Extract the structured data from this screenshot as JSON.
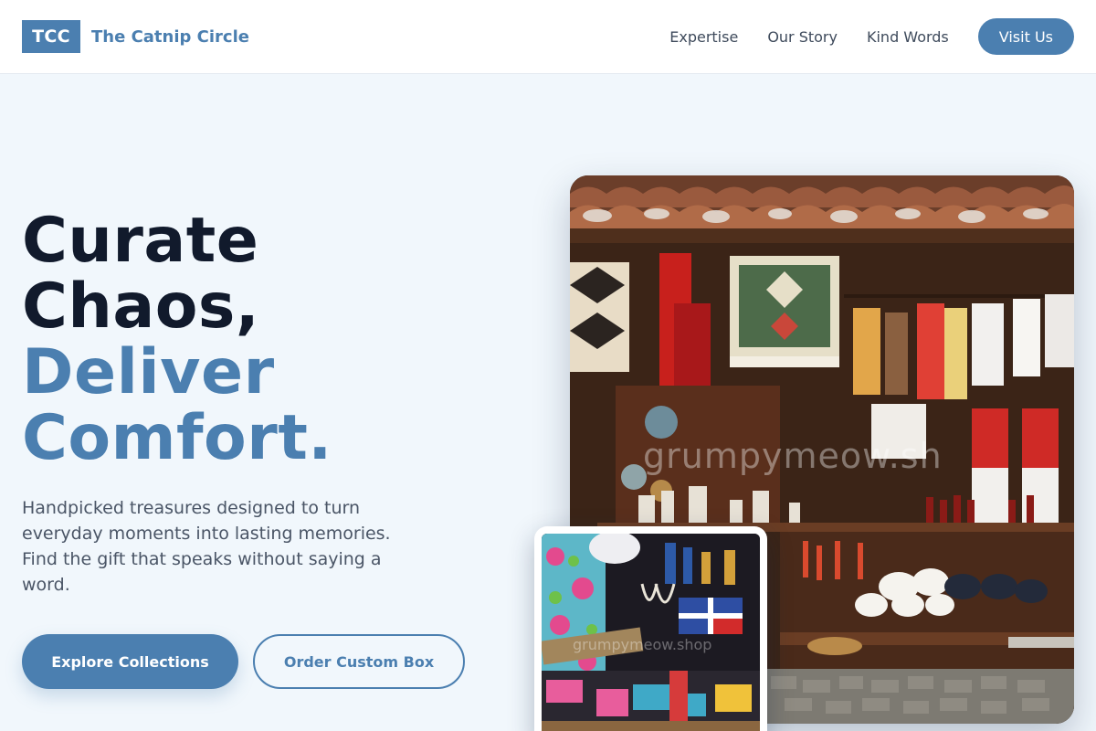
{
  "header": {
    "logo_mark": "TCC",
    "brand_name": "The Catnip Circle",
    "nav": [
      {
        "label": "Expertise"
      },
      {
        "label": "Our Story"
      },
      {
        "label": "Kind Words"
      }
    ],
    "cta_label": "Visit Us"
  },
  "hero": {
    "headline_line1": "Curate",
    "headline_line2": "Chaos,",
    "headline_line3": "Deliver",
    "headline_line4": "Comfort.",
    "lead": "Handpicked treasures designed to turn everyday moments into lasting memories. Find the gift that speaks without saying a word.",
    "primary_button": "Explore Collections",
    "secondary_button": "Order Custom Box",
    "main_image": {
      "subject": "market-stall-photo",
      "watermark": "grumpymeow.sh"
    },
    "inset_image": {
      "subject": "souvenir-stall-photo",
      "watermark": "grumpymeow.shop"
    }
  },
  "colors": {
    "brand": "#4b7fb0",
    "heading_dark": "#111a2c",
    "page_background": "#f1f7fc",
    "body_text": "#4a5566"
  }
}
